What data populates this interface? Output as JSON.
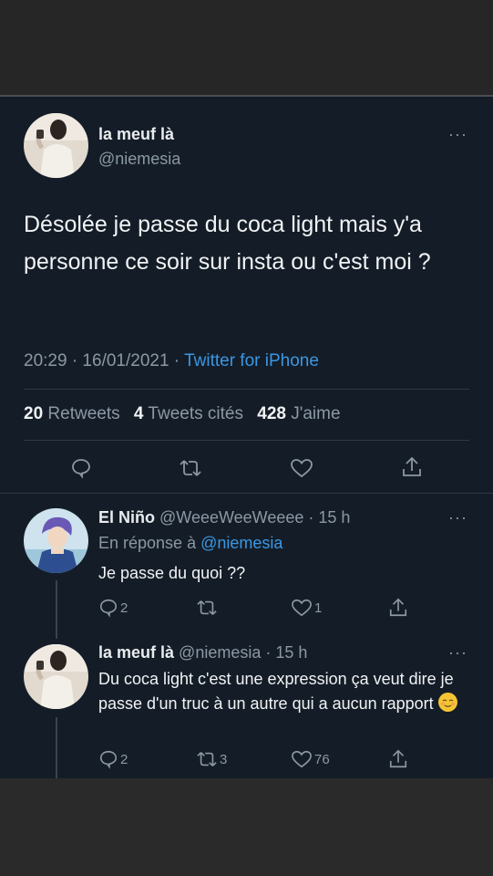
{
  "main_tweet": {
    "author_name": "la meuf là",
    "author_handle": "@niemesia",
    "text": "Désolée je passe du coca light mais y'a personne ce soir sur insta ou c'est moi ?",
    "time": "20:29 · 16/01/2021 ·",
    "source": "Twitter for iPhone",
    "retweets_count": "20",
    "retweets_label": "Retweets",
    "quotes_count": "4",
    "quotes_label": "Tweets cités",
    "likes_count": "428",
    "likes_label": "J'aime",
    "more_label": "···"
  },
  "replies": [
    {
      "author_name": "El Niño",
      "author_handle": "@WeeeWeeWeeee",
      "time": "· 15 h",
      "in_reply_prefix": "En réponse à",
      "in_reply_mention": "@niemesia",
      "text": "Je passe du quoi ??",
      "reply_count": "2",
      "retweet_count": "",
      "like_count": "1",
      "more_label": "···"
    },
    {
      "author_name": "la meuf là",
      "author_handle": "@niemesia",
      "time": "· 15 h",
      "text": "Du coca light c'est une expression ça veut dire je passe d'un truc à un autre qui a aucun rapport",
      "emoji": "relieved-face",
      "reply_count": "2",
      "retweet_count": "3",
      "like_count": "76",
      "more_label": "···"
    }
  ],
  "colors": {
    "background": "#141d27",
    "text": "#e9ecef",
    "secondary": "#8b98a5",
    "link": "#3b97e3"
  }
}
